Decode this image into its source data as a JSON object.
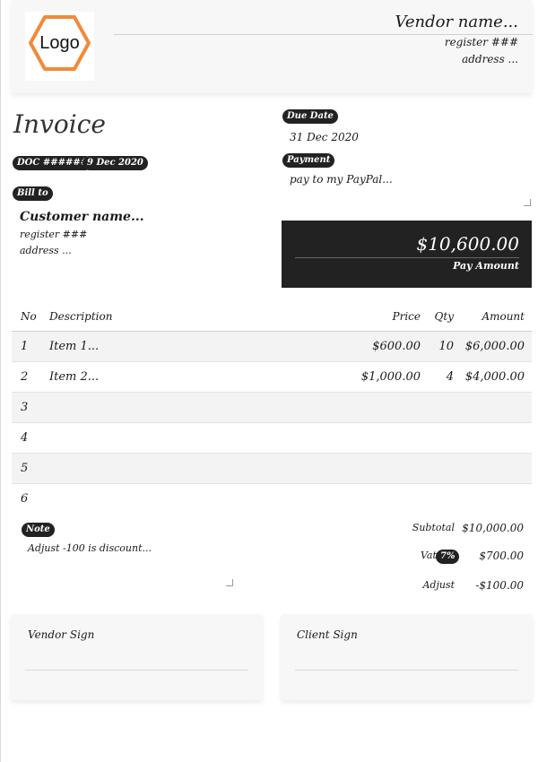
{
  "header": {
    "logo_text": "Logo",
    "vendor_name": "Vendor name...",
    "vendor_register": "register ###",
    "vendor_address": "address ..."
  },
  "invoice": {
    "title": "Invoice",
    "doc_number": "DOC ######",
    "doc_date": "9 Dec 2020",
    "bill_to_label": "Bill to",
    "customer_name": "Customer name...",
    "customer_register": "register ###",
    "customer_address": "address ..."
  },
  "due": {
    "label": "Due Date",
    "value": "31 Dec 2020"
  },
  "payment": {
    "label": "Payment",
    "value": "pay to my PayPal..."
  },
  "pay_box": {
    "amount": "$10,600.00",
    "label": "Pay Amount"
  },
  "table": {
    "headers": {
      "no": "No",
      "description": "Description",
      "price": "Price",
      "qty": "Qty",
      "amount": "Amount"
    },
    "rows": [
      {
        "no": "1",
        "description": "Item 1...",
        "price": "$600.00",
        "qty": "10",
        "amount": "$6,000.00"
      },
      {
        "no": "2",
        "description": "Item 2...",
        "price": "$1,000.00",
        "qty": "4",
        "amount": "$4,000.00"
      },
      {
        "no": "3",
        "description": "",
        "price": "",
        "qty": "",
        "amount": ""
      },
      {
        "no": "4",
        "description": "",
        "price": "",
        "qty": "",
        "amount": ""
      },
      {
        "no": "5",
        "description": "",
        "price": "",
        "qty": "",
        "amount": ""
      },
      {
        "no": "6",
        "description": "",
        "price": "",
        "qty": "",
        "amount": ""
      }
    ]
  },
  "note": {
    "label": "Note",
    "value": "Adjust -100 is discount..."
  },
  "totals": {
    "subtotal_label": "Subtotal",
    "subtotal_value": "$10,000.00",
    "vat_label": "Vat",
    "vat_rate": "7%",
    "vat_value": "$700.00",
    "adjust_label": "Adjust",
    "adjust_value": "-$100.00"
  },
  "signatures": {
    "vendor_label": "Vendor Sign",
    "client_label": "Client Sign"
  },
  "colors": {
    "logo_accent": "#f08a3a",
    "dark": "#222222"
  }
}
